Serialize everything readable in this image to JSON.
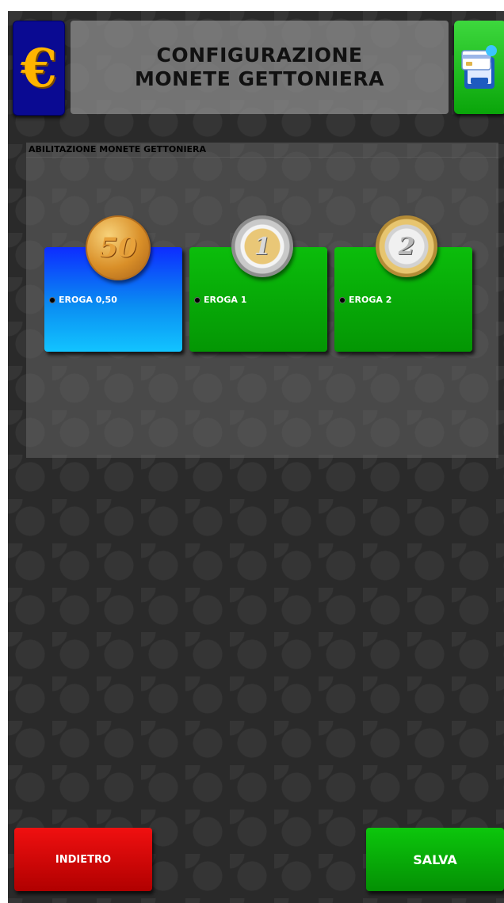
{
  "header": {
    "title_line1": "CONFIGURAZIONE",
    "title_line2": "MONETE GETTONIERA",
    "left_icon": "euro-icon",
    "left_icon_glyph": "€",
    "right_icon": "payment-card-icon"
  },
  "panel": {
    "title": "ABILITAZIONE MONETE GETTONIERA",
    "coins": [
      {
        "label": "EROGA 0,50",
        "coin_text": "50",
        "card_color": "#0d6cf5"
      },
      {
        "label": "EROGA 1",
        "coin_text": "1",
        "card_color": "#07aa07"
      },
      {
        "label": "EROGA 2",
        "coin_text": "2",
        "card_color": "#07aa07"
      }
    ]
  },
  "footer": {
    "back_label": "INDIETRO",
    "save_label": "SALVA"
  },
  "colors": {
    "back": "#d00000",
    "save": "#05a805",
    "euro_button": "#0a0a92",
    "euro_glyph": "#ffb400"
  }
}
